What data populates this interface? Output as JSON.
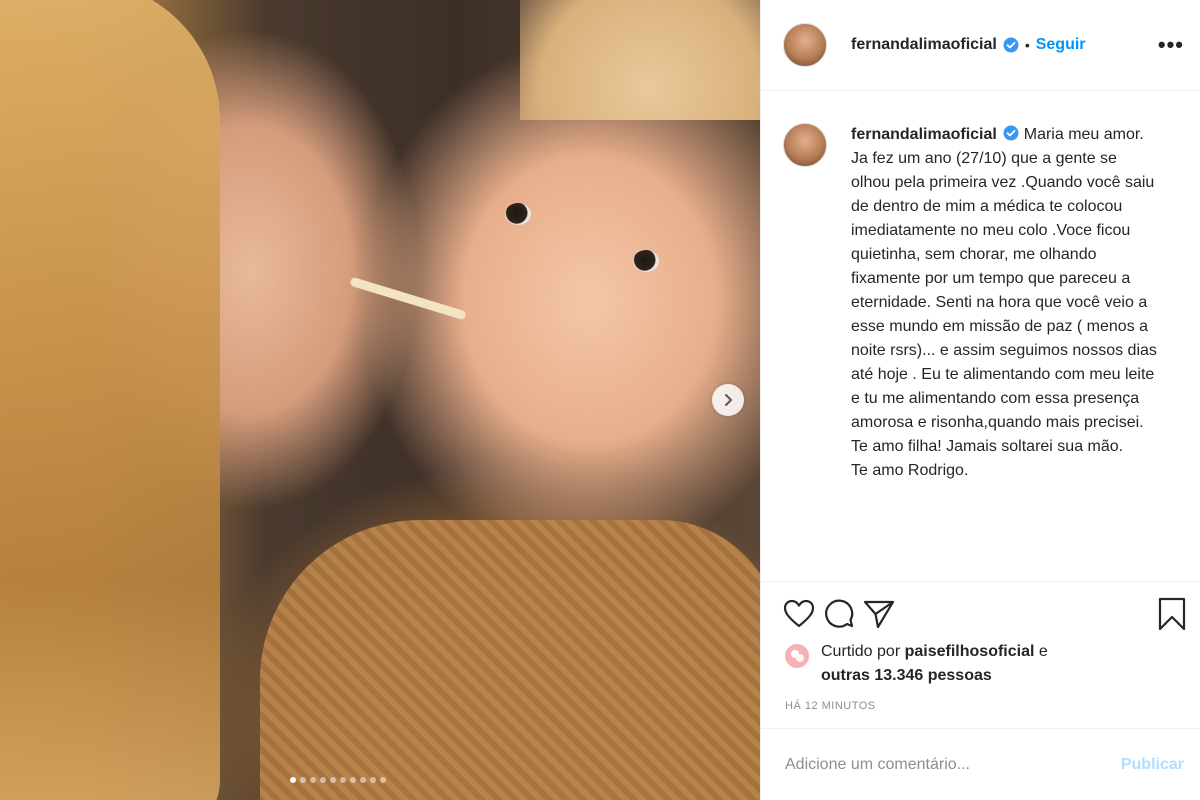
{
  "post": {
    "username": "fernandalimaoficial",
    "follow_label": "Seguir",
    "separator": "•",
    "more_label": "•••",
    "caption": {
      "username": "fernandalimaoficial",
      "lines": [
        "Maria meu amor.",
        "Ja fez um ano (27/10) que a gente se olhou pela primeira vez .Quando você saiu de dentro de mim a médica te colocou imediatamente no meu colo .Voce ficou quietinha, sem chorar, me olhando fixamente por um tempo que pareceu a eternidade. Senti na hora que você veio a esse mundo em missão de paz ( menos a noite rsrs)... e assim seguimos nossos dias até hoje . Eu te alimentando com meu leite e tu me alimentando com essa presença amorosa e risonha,quando mais precisei.",
        "Te amo filha! Jamais soltarei sua mão.",
        "Te amo Rodrigo."
      ]
    },
    "likes": {
      "prefix": "Curtido por",
      "user": "paisefilhosoficial",
      "connector": "e",
      "others": "outras 13.346 pessoas"
    },
    "time": "HÁ 12 MINUTOS",
    "comment": {
      "placeholder": "Adicione um comentário...",
      "publish_label": "Publicar"
    },
    "carousel": {
      "total": 10,
      "active_index": 0
    },
    "colors": {
      "accent": "#0095f6",
      "publish_disabled": "#b2dffc",
      "verified": "#3897f0",
      "meta_text": "#8e8e8e"
    },
    "icons": [
      "heart-icon",
      "comment-icon",
      "share-icon",
      "bookmark-icon",
      "verified-icon",
      "next-arrow-icon",
      "more-icon"
    ]
  }
}
